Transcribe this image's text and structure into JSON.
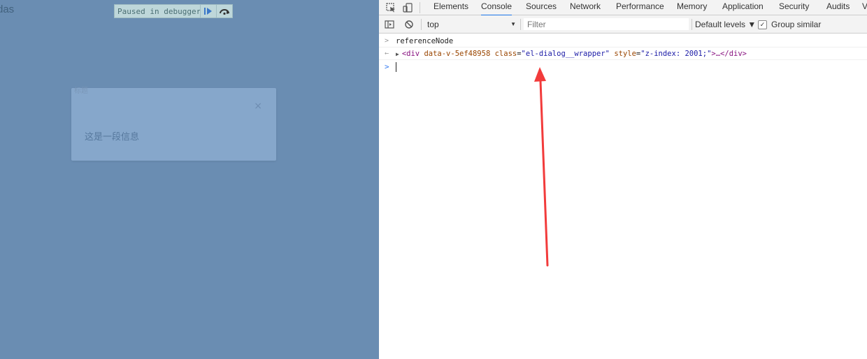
{
  "page": {
    "cut_text": "das",
    "pause_text": "Paused in debugger",
    "dialog": {
      "title_fragment": "标题",
      "close_glyph": "×",
      "message": "这是一段信息"
    }
  },
  "devtools": {
    "tabs": [
      {
        "label": "Elements",
        "active": false
      },
      {
        "label": "Console",
        "active": true
      },
      {
        "label": "Sources",
        "active": false
      },
      {
        "label": "Network",
        "active": false
      },
      {
        "label": "Performance",
        "active": false
      },
      {
        "label": "Memory",
        "active": false
      },
      {
        "label": "Application",
        "active": false
      },
      {
        "label": "Security",
        "active": false
      },
      {
        "label": "Audits",
        "active": false
      },
      {
        "label": "V",
        "active": false
      }
    ],
    "toolbar": {
      "context": "top",
      "filter_placeholder": "Filter",
      "levels": "Default levels ▼",
      "group_similar": "Group similar",
      "group_similar_checked": true
    },
    "console": {
      "input_command": "referenceNode",
      "result": {
        "tag_open": "<div",
        "attr1_name": "data-v-5ef48958",
        "attr2_name": "class",
        "attr2_value": "\"el-dialog__wrapper\"",
        "attr3_name": "style",
        "attr3_value": "\"z-index: 2001;\"",
        "tag_close": ">…</div>"
      }
    }
  },
  "colors": {
    "page_overlay": "#6a8db2",
    "annotation_arrow": "#f23b3b",
    "active_tab": "#1a73e8"
  }
}
